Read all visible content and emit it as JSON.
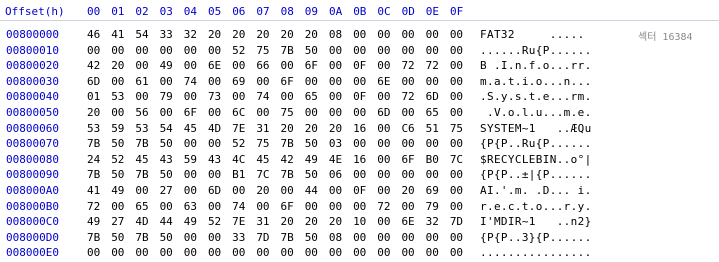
{
  "header": {
    "offset_label": "Offset(h)",
    "columns": [
      "00",
      "01",
      "02",
      "03",
      "04",
      "05",
      "06",
      "07",
      "08",
      "09",
      "0A",
      "0B",
      "0C",
      "0D",
      "0E",
      "0F"
    ]
  },
  "sector_label": "섹터 16384",
  "rows": [
    {
      "offset": "00800000",
      "bytes": [
        "46",
        "41",
        "54",
        "33",
        "32",
        "20",
        "20",
        "20",
        "20",
        "20",
        "08",
        "00",
        "00",
        "00",
        "00",
        "00"
      ],
      "ascii": "FAT32     ....."
    },
    {
      "offset": "00800010",
      "bytes": [
        "00",
        "00",
        "00",
        "00",
        "00",
        "00",
        "52",
        "75",
        "7B",
        "50",
        "00",
        "00",
        "00",
        "00",
        "00",
        "00"
      ],
      "ascii": "......Ru{P......"
    },
    {
      "offset": "00800020",
      "bytes": [
        "42",
        "20",
        "00",
        "49",
        "00",
        "6E",
        "00",
        "66",
        "00",
        "6F",
        "00",
        "0F",
        "00",
        "72",
        "72",
        "00"
      ],
      "ascii": "B .I.n.f.o...rr."
    },
    {
      "offset": "00800030",
      "bytes": [
        "6D",
        "00",
        "61",
        "00",
        "74",
        "00",
        "69",
        "00",
        "6F",
        "00",
        "00",
        "00",
        "6E",
        "00",
        "00",
        "00"
      ],
      "ascii": "m.a.t.i.o...n..."
    },
    {
      "offset": "00800040",
      "bytes": [
        "01",
        "53",
        "00",
        "79",
        "00",
        "73",
        "00",
        "74",
        "00",
        "65",
        "00",
        "0F",
        "00",
        "72",
        "6D",
        "00"
      ],
      "ascii": ".S.y.s.t.e...rm."
    },
    {
      "offset": "00800050",
      "bytes": [
        "20",
        "00",
        "56",
        "00",
        "6F",
        "00",
        "6C",
        "00",
        "75",
        "00",
        "00",
        "00",
        "6D",
        "00",
        "65",
        "00"
      ],
      "ascii": " .V.o.l.u...m.e."
    },
    {
      "offset": "00800060",
      "bytes": [
        "53",
        "59",
        "53",
        "54",
        "45",
        "4D",
        "7E",
        "31",
        "20",
        "20",
        "20",
        "16",
        "00",
        "C6",
        "51",
        "75"
      ],
      "ascii": "SYSTEM~1   ..ÆQu"
    },
    {
      "offset": "00800070",
      "bytes": [
        "7B",
        "50",
        "7B",
        "50",
        "00",
        "00",
        "52",
        "75",
        "7B",
        "50",
        "03",
        "00",
        "00",
        "00",
        "00",
        "00"
      ],
      "ascii": "{P{P..Ru{P......"
    },
    {
      "offset": "00800080",
      "bytes": [
        "24",
        "52",
        "45",
        "43",
        "59",
        "43",
        "4C",
        "45",
        "42",
        "49",
        "4E",
        "16",
        "00",
        "6F",
        "B0",
        "7C"
      ],
      "ascii": "$RECYCLEBIN..o°|"
    },
    {
      "offset": "00800090",
      "bytes": [
        "7B",
        "50",
        "7B",
        "50",
        "00",
        "00",
        "B1",
        "7C",
        "7B",
        "50",
        "06",
        "00",
        "00",
        "00",
        "00",
        "00"
      ],
      "ascii": "{P{P..±|{P......"
    },
    {
      "offset": "008000A0",
      "bytes": [
        "41",
        "49",
        "00",
        "27",
        "00",
        "6D",
        "00",
        "20",
        "00",
        "44",
        "00",
        "0F",
        "00",
        "20",
        "69",
        "00"
      ],
      "ascii": "AI.'.m. .D... i."
    },
    {
      "offset": "008000B0",
      "bytes": [
        "72",
        "00",
        "65",
        "00",
        "63",
        "00",
        "74",
        "00",
        "6F",
        "00",
        "00",
        "00",
        "72",
        "00",
        "79",
        "00"
      ],
      "ascii": "r.e.c.t.o...r.y."
    },
    {
      "offset": "008000C0",
      "bytes": [
        "49",
        "27",
        "4D",
        "44",
        "49",
        "52",
        "7E",
        "31",
        "20",
        "20",
        "20",
        "10",
        "00",
        "6E",
        "32",
        "7D"
      ],
      "ascii": "I'MDIR~1   ..n2}"
    },
    {
      "offset": "008000D0",
      "bytes": [
        "7B",
        "50",
        "7B",
        "50",
        "00",
        "00",
        "33",
        "7D",
        "7B",
        "50",
        "08",
        "00",
        "00",
        "00",
        "00",
        "00"
      ],
      "ascii": "{P{P..3}{P......"
    },
    {
      "offset": "008000E0",
      "bytes": [
        "00",
        "00",
        "00",
        "00",
        "00",
        "00",
        "00",
        "00",
        "00",
        "00",
        "00",
        "00",
        "00",
        "00",
        "00",
        "00"
      ],
      "ascii": "................"
    }
  ]
}
